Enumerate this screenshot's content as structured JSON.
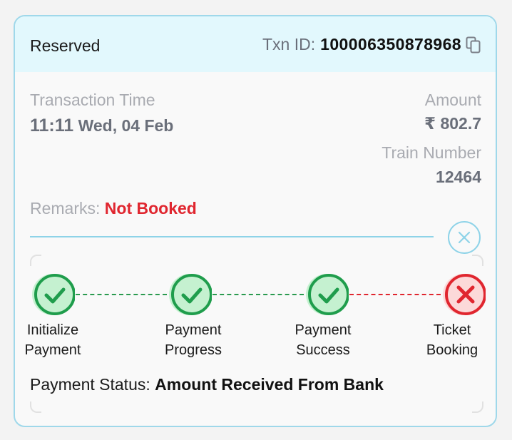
{
  "header": {
    "status": "Reserved",
    "txn_label": "Txn ID:",
    "txn_id": "100006350878968"
  },
  "transaction": {
    "time_label": "Transaction Time",
    "time": "11:11",
    "date": "Wed, 04 Feb"
  },
  "amount": {
    "label": "Amount",
    "value": "₹ 802.7"
  },
  "train": {
    "label": "Train Number",
    "value": "12464"
  },
  "remarks": {
    "label": "Remarks:",
    "value": "Not Booked"
  },
  "steps": [
    {
      "line1": "Initialize",
      "line2": "Payment",
      "state": "success"
    },
    {
      "line1": "Payment",
      "line2": "Progress",
      "state": "success"
    },
    {
      "line1": "Payment",
      "line2": "Success",
      "state": "success"
    },
    {
      "line1": "Ticket",
      "line2": "Booking",
      "state": "failed"
    }
  ],
  "payment_status": {
    "label": "Payment Status:",
    "value": "Amount Received From Bank"
  },
  "colors": {
    "success": "#1f9d4c",
    "failed": "#e0262f",
    "accent": "#8ed3e8",
    "header_bg": "#e2f8fd"
  }
}
